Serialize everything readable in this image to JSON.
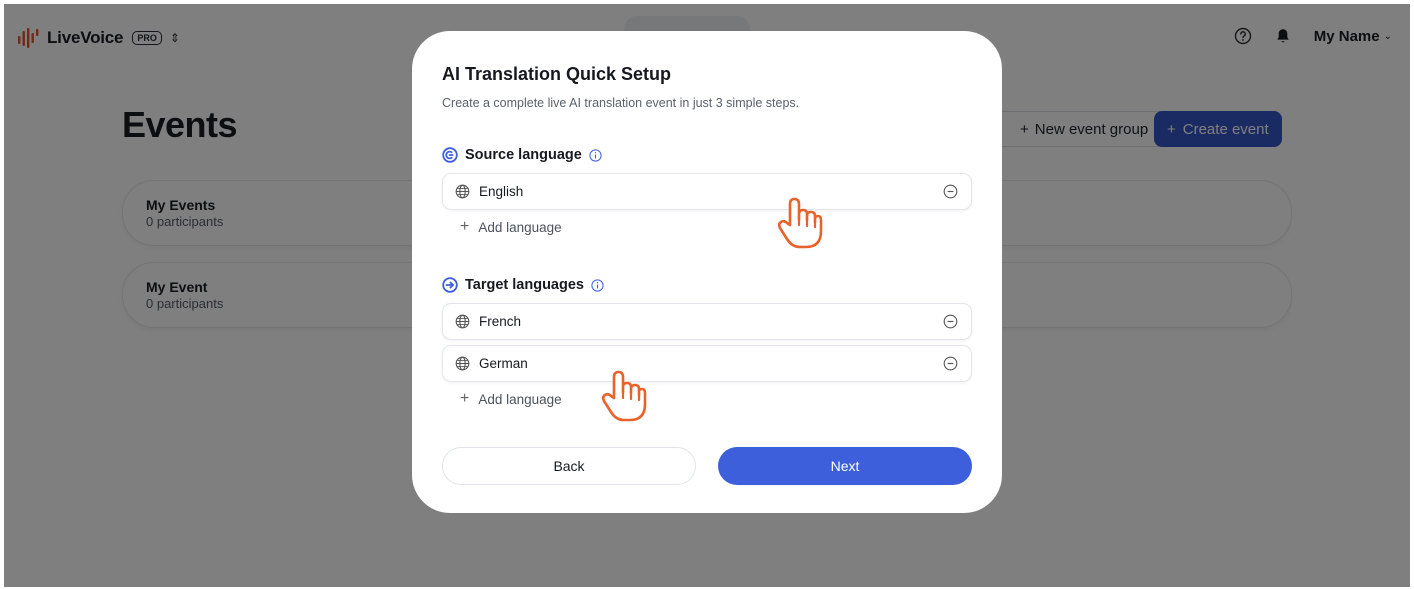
{
  "app": {
    "brand_name": "LiveVoice",
    "plan_badge": "PRO",
    "switcher_icon": "chevron-up-down-icon",
    "user_name": "My Name",
    "accent_color": "#3d5fdc",
    "logo_color": "#e2552b"
  },
  "page": {
    "title": "Events",
    "new_group_label": "New event group",
    "create_event_label": "Create event",
    "events": [
      {
        "name": "My Events",
        "participants": "0 participants"
      },
      {
        "name": "My Event",
        "participants": "0 participants"
      }
    ]
  },
  "modal": {
    "title": "AI Translation Quick Setup",
    "subtitle": "Create a complete live AI translation event in just 3 simple steps.",
    "source": {
      "label": "Source language",
      "languages": [
        "English"
      ],
      "add_label": "Add language"
    },
    "target": {
      "label": "Target languages",
      "languages": [
        "French",
        "German"
      ],
      "add_label": "Add language"
    },
    "back_label": "Back",
    "next_label": "Next"
  },
  "cursors": {
    "icon": "pointing-hand-cursor-icon",
    "color": "#e8622c"
  }
}
